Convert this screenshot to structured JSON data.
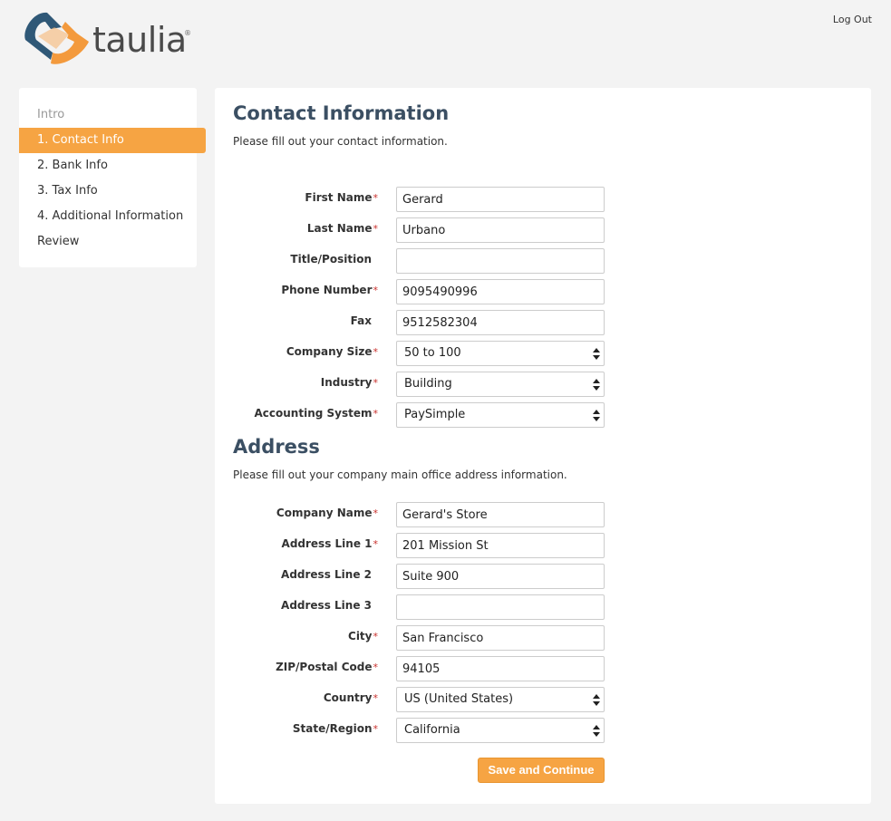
{
  "brand": {
    "name": "taulia",
    "reg": "®"
  },
  "header": {
    "logout_label": "Log Out"
  },
  "sidebar": {
    "items": [
      {
        "label": "Intro"
      },
      {
        "label": "1. Contact Info"
      },
      {
        "label": "2. Bank Info"
      },
      {
        "label": "3. Tax Info"
      },
      {
        "label": "4. Additional Information"
      },
      {
        "label": "Review"
      }
    ]
  },
  "contact": {
    "title": "Contact Information",
    "description": "Please fill out your contact information.",
    "fields": [
      {
        "label": "First Name",
        "value": "Gerard"
      },
      {
        "label": "Last Name",
        "value": "Urbano"
      },
      {
        "label": "Title/Position",
        "value": ""
      },
      {
        "label": "Phone Number",
        "value": "9095490996"
      },
      {
        "label": "Fax",
        "value": "9512582304"
      },
      {
        "label": "Company Size",
        "value": "50 to 100"
      },
      {
        "label": "Industry",
        "value": "Building"
      },
      {
        "label": "Accounting System",
        "value": "PaySimple"
      }
    ]
  },
  "address": {
    "title": "Address",
    "description": "Please fill out your company main office address information.",
    "fields": [
      {
        "label": "Company Name",
        "value": "Gerard's Store"
      },
      {
        "label": "Address Line 1",
        "value": "201 Mission St"
      },
      {
        "label": "Address Line 2",
        "value": "Suite 900"
      },
      {
        "label": "Address Line 3",
        "value": ""
      },
      {
        "label": "City",
        "value": "San Francisco"
      },
      {
        "label": "ZIP/Postal Code",
        "value": "94105"
      },
      {
        "label": "Country",
        "value": "US (United States)"
      },
      {
        "label": "State/Region",
        "value": "California"
      }
    ]
  },
  "required_marker": "*",
  "actions": {
    "save_label": "Save and Continue"
  },
  "colors": {
    "accent": "#f6a443",
    "title": "#3b4f63",
    "required": "#c9302c",
    "logo_blue": "#2f5877",
    "logo_orange": "#f39a3d"
  }
}
